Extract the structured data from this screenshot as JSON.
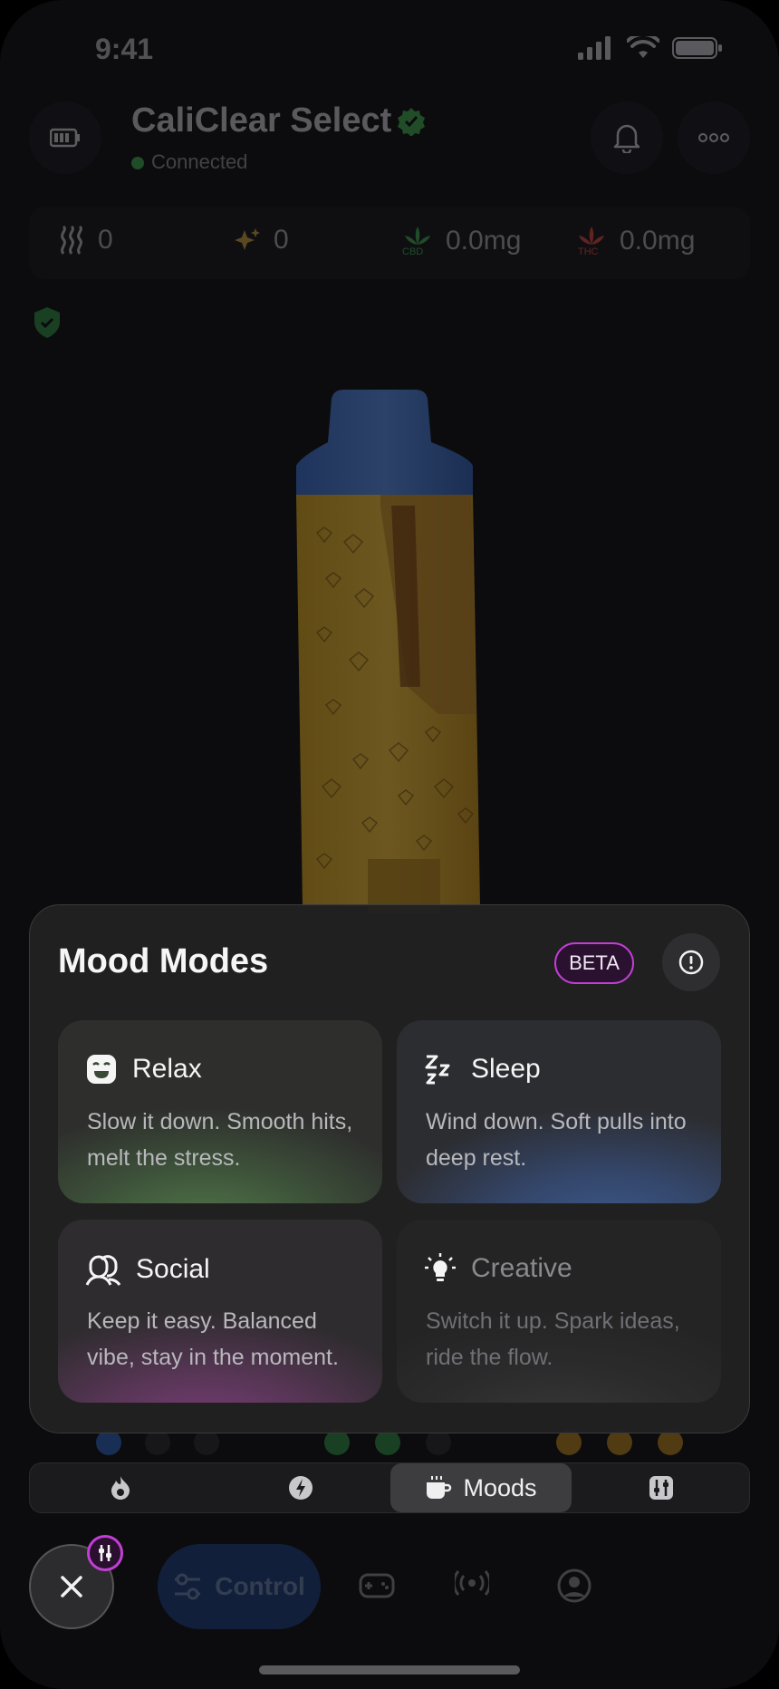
{
  "status_bar": {
    "time": "9:41"
  },
  "header": {
    "device_name": "CaliClear Select",
    "connection_status": "Connected"
  },
  "stats": {
    "puffs": "0",
    "sparks": "0",
    "cbd_label": "CBD",
    "cbd_value": "0.0mg",
    "thc_label": "THC",
    "thc_value": "0.0mg"
  },
  "mood_modes": {
    "title": "Mood Modes",
    "badge": "BETA",
    "modes": [
      {
        "name": "Relax",
        "description": "Slow it down. Smooth hits, melt the stress.",
        "icon": "smile-face-icon"
      },
      {
        "name": "Sleep",
        "description": "Wind down. Soft pulls into deep rest.",
        "icon": "zzz-icon"
      },
      {
        "name": "Social",
        "description": "Keep it easy. Balanced vibe, stay in the moment.",
        "icon": "people-icon"
      },
      {
        "name": "Creative",
        "description": "Switch it up. Spark ideas, ride the flow.",
        "icon": "lightbulb-icon"
      }
    ]
  },
  "mode_switcher": {
    "items": [
      "flame-icon",
      "bolt-icon",
      "Moods",
      "sliders-icon"
    ],
    "active_label": "Moods"
  },
  "bottom_nav": {
    "control_label": "Control"
  },
  "colors": {
    "accent_purple": "#c13fd4",
    "connected_green": "#3ea84e",
    "control_blue": "#1b3d7a"
  }
}
